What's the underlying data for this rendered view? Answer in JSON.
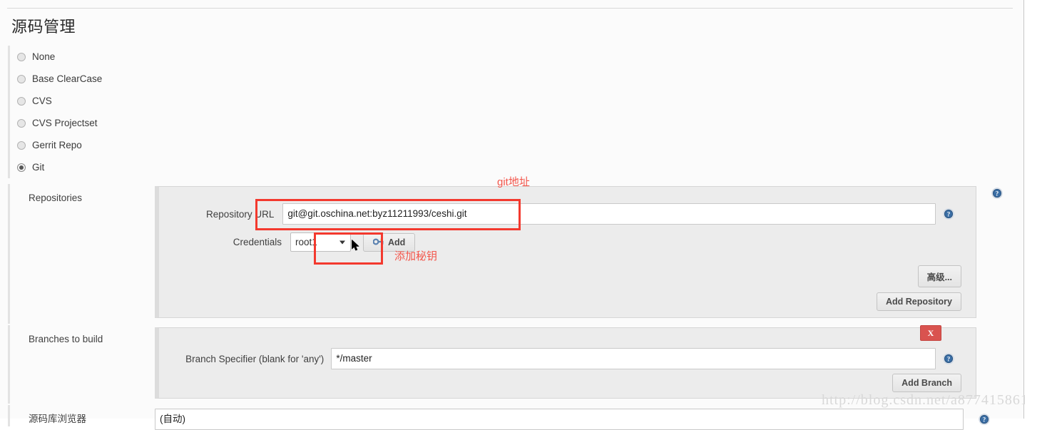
{
  "page": {
    "title": "源码管理"
  },
  "scm_options": [
    {
      "label": "None",
      "selected": false
    },
    {
      "label": "Base ClearCase",
      "selected": false
    },
    {
      "label": "CVS",
      "selected": false
    },
    {
      "label": "CVS Projectset",
      "selected": false
    },
    {
      "label": "Gerrit Repo",
      "selected": false
    },
    {
      "label": "Git",
      "selected": true
    }
  ],
  "rows": {
    "repositories": {
      "label": "Repositories",
      "repository_url": {
        "label": "Repository URL",
        "value": "git@git.oschina.net:byz11211993/ceshi.git"
      },
      "credentials": {
        "label": "Credentials",
        "selected": "root1",
        "add_button": "Add",
        "add_button_icon": "key-icon"
      },
      "advanced_button": "高级...",
      "add_repository_button": "Add Repository",
      "help_icon": "help-icon"
    },
    "branches": {
      "label": "Branches to build",
      "branch_specifier": {
        "label": "Branch Specifier (blank for 'any')",
        "value": "*/master"
      },
      "delete_button": "X",
      "add_branch_button": "Add Branch",
      "help_icon": "help-icon"
    },
    "browser": {
      "label": "源码库浏览器",
      "value": "(自动)"
    }
  },
  "annotations": [
    {
      "text": "git地址"
    },
    {
      "text": "添加秘钥"
    }
  ],
  "watermark": "http://blog.csdn.net/a877415861",
  "colors": {
    "annotation_red": "#f3564b",
    "danger_red": "#d9534f",
    "help_blue": "#3a6ea5"
  }
}
